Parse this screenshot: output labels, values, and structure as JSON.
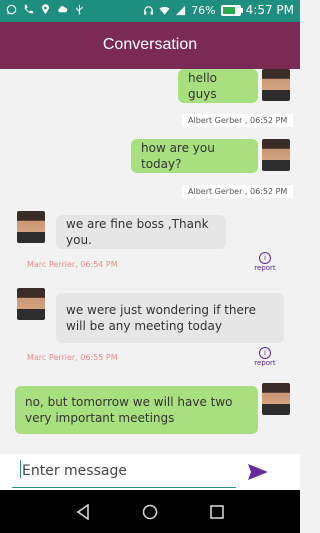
{
  "status_bar": {
    "battery": "76%",
    "battery_level": 0.76,
    "time": "4:57 PM"
  },
  "app_bar": {
    "title": "Conversation"
  },
  "messages": [
    {
      "text": "hello guys",
      "direction": "outgoing",
      "meta": "Albert Gerber , 06:52 PM"
    },
    {
      "text": "how are you today?",
      "direction": "outgoing",
      "meta": "Albert Gerber , 06:52 PM"
    },
    {
      "text": "we are fine boss ,Thank you.",
      "direction": "incoming",
      "meta": "Marc Perrier, 06:54 PM",
      "report": "report"
    },
    {
      "text": "we were just wondering if there will be any meeting today",
      "direction": "incoming",
      "meta": "Marc Perrier, 06:55 PM",
      "report": "report"
    },
    {
      "text": "no, but tomorrow we will have two very important meetings",
      "direction": "outgoing"
    }
  ],
  "composer": {
    "placeholder": "Enter message"
  },
  "colors": {
    "app_bar": "#7a2a55",
    "status_bar": "#1e8f7f",
    "outgoing_bubble": "#a9e07f",
    "incoming_bubble": "#e6e6e6",
    "accent": "#6a2a9f",
    "incoming_meta": "#e88b8b"
  },
  "icons": [
    "whatsapp-icon",
    "phone-icon",
    "location-icon",
    "cloud-icon",
    "usb-icon",
    "headphones-icon",
    "wifi-icon",
    "signal-icon",
    "battery-icon",
    "send-icon",
    "back-icon",
    "home-icon",
    "recents-icon",
    "report-icon"
  ]
}
